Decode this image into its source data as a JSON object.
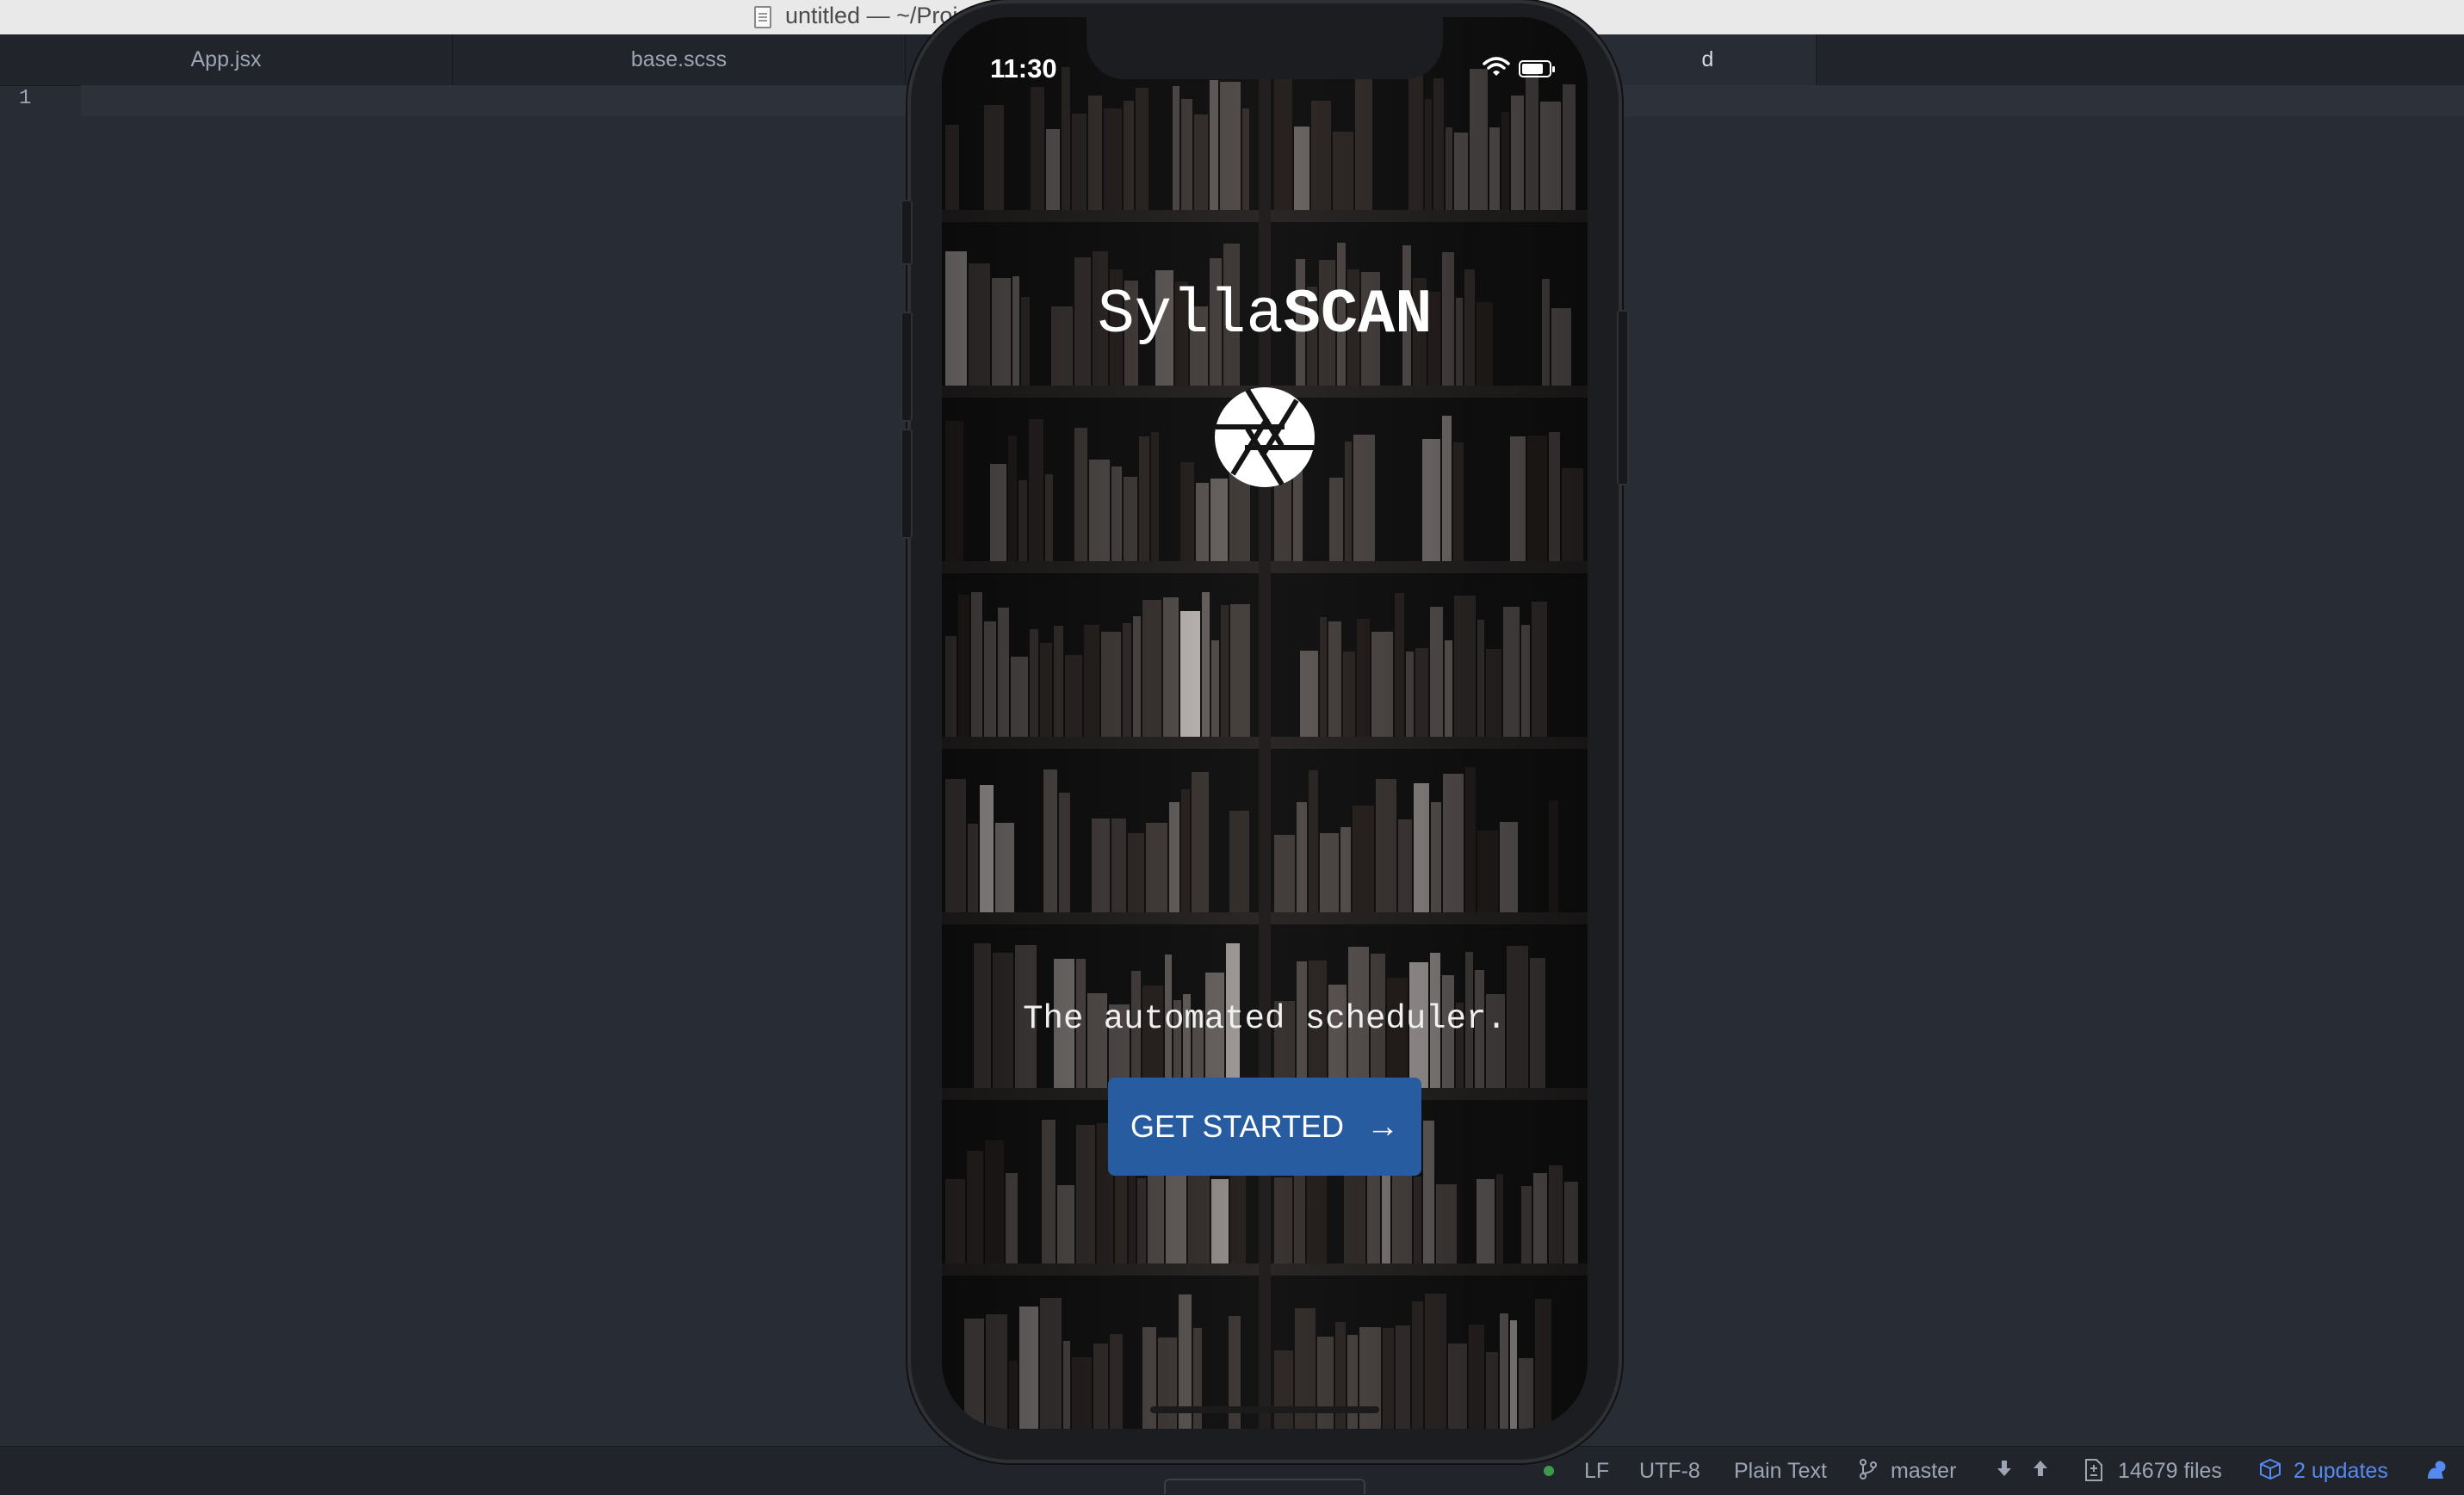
{
  "window": {
    "title": "untitled — ~/Proj"
  },
  "tabs": [
    {
      "label": "App.jsx"
    },
    {
      "label": "base.scss"
    },
    {
      "label": ""
    },
    {
      "label": "d"
    }
  ],
  "editor": {
    "line_number": "1"
  },
  "simulator": {
    "status": {
      "time": "11:30"
    },
    "app": {
      "title_light": "Sylla",
      "title_bold": "SCAN",
      "tagline": "The automated scheduler.",
      "cta_label": "GET STARTED",
      "cta_color": "#275ca0"
    },
    "icons": [
      "wifi-icon",
      "battery-icon",
      "camera-aperture-icon",
      "arrow-right-icon"
    ]
  },
  "statusbar": {
    "line_ending": "LF",
    "encoding": "UTF-8",
    "grammar": "Plain Text",
    "branch": "master",
    "files": "14679 files",
    "updates": "2 updates"
  }
}
